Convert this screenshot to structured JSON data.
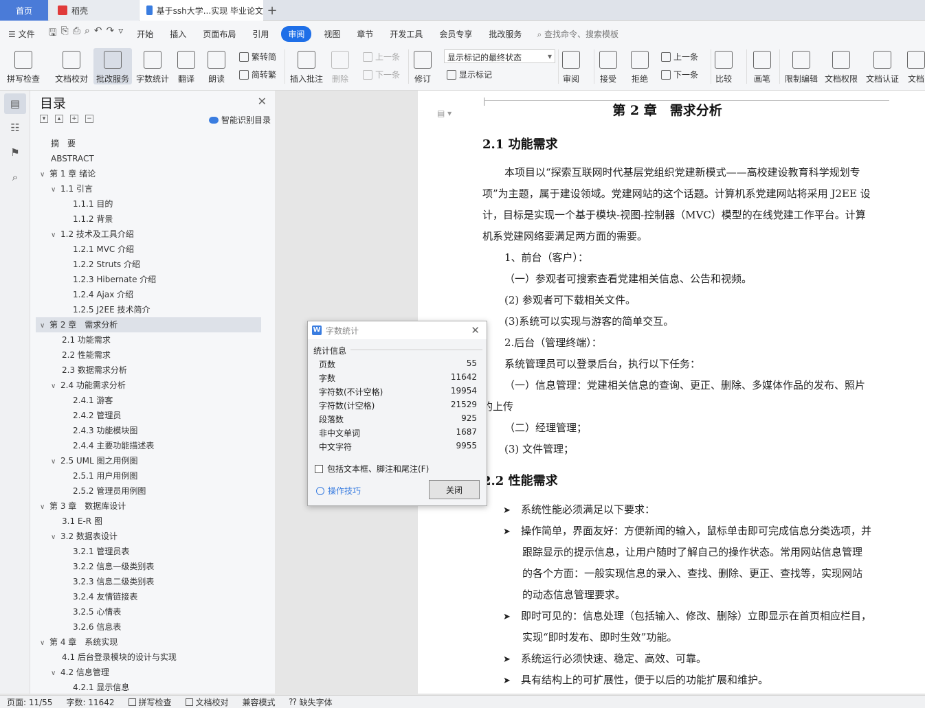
{
  "tabs": {
    "home": "首页",
    "daoke": "稻壳",
    "doc": "基于ssh大学...实现 毕业论文",
    "add": "+"
  },
  "menu": {
    "file": "文件",
    "items": [
      "开始",
      "插入",
      "页面布局",
      "引用",
      "审阅",
      "视图",
      "章节",
      "开发工具",
      "会员专享",
      "批改服务"
    ],
    "active": "审阅",
    "search": "查找命令、搜索模板"
  },
  "ribbon": {
    "spell": "拼写检查",
    "proof": "文档校对",
    "revise_service": "批改服务",
    "word_count": "字数统计",
    "translate": "翻译",
    "read": "朗读",
    "trad": "繁转简",
    "simp": "简转繁",
    "insert_comment": "插入批注",
    "delete": "删除",
    "prev": "上一条",
    "next": "下一条",
    "track": "修订",
    "display_combo": "显示标记的最终状态",
    "show_marks": "显示标记",
    "review": "审阅",
    "accept": "接受",
    "reject": "拒绝",
    "prev2": "上一条",
    "next2": "下一条",
    "compare": "比较",
    "pen": "画笔",
    "restrict": "限制编辑",
    "perm": "文档权限",
    "cert": "文档认证",
    "more": "文档"
  },
  "toc": {
    "title": "目录",
    "smart": "智能识别目录",
    "items": [
      {
        "label": "摘　要",
        "level": 0,
        "tw": ""
      },
      {
        "label": "ABSTRACT",
        "level": 0,
        "tw": ""
      },
      {
        "label": "第 1 章  绪论",
        "level": 0,
        "tw": "∨"
      },
      {
        "label": "1.1  引言",
        "level": 1,
        "tw": "∨"
      },
      {
        "label": "1.1.1 目的",
        "level": 2,
        "tw": ""
      },
      {
        "label": "1.1.2  背景",
        "level": 2,
        "tw": ""
      },
      {
        "label": "1.2  技术及工具介绍",
        "level": 1,
        "tw": "∨"
      },
      {
        "label": "1.2.1 MVC 介绍",
        "level": 2,
        "tw": ""
      },
      {
        "label": "1.2.2 Struts 介绍",
        "level": 2,
        "tw": ""
      },
      {
        "label": "1.2.3 Hibernate 介绍",
        "level": 2,
        "tw": ""
      },
      {
        "label": "1.2.4 Ajax 介绍",
        "level": 2,
        "tw": ""
      },
      {
        "label": "1.2.5 J2EE 技术简介",
        "level": 2,
        "tw": ""
      },
      {
        "label": "第 2 章　需求分析",
        "level": 0,
        "tw": "∨",
        "selected": true
      },
      {
        "label": "2.1  功能需求",
        "level": 1,
        "tw": ""
      },
      {
        "label": "2.2  性能需求",
        "level": 1,
        "tw": ""
      },
      {
        "label": "2.3  数据需求分析",
        "level": 1,
        "tw": ""
      },
      {
        "label": "2.4  功能需求分析",
        "level": 1,
        "tw": "∨"
      },
      {
        "label": "2.4.1  游客",
        "level": 2,
        "tw": ""
      },
      {
        "label": "2.4.2  管理员",
        "level": 2,
        "tw": ""
      },
      {
        "label": "2.4.3  功能模块图",
        "level": 2,
        "tw": ""
      },
      {
        "label": "2.4.4  主要功能描述表",
        "level": 2,
        "tw": ""
      },
      {
        "label": "2.5 UML 图之用例图",
        "level": 1,
        "tw": "∨"
      },
      {
        "label": "2.5.1  用户用例图",
        "level": 2,
        "tw": ""
      },
      {
        "label": "2.5.2  管理员用例图",
        "level": 2,
        "tw": ""
      },
      {
        "label": "第 3 章　数据库设计",
        "level": 0,
        "tw": "∨"
      },
      {
        "label": "3.1 E-R  图",
        "level": 1,
        "tw": ""
      },
      {
        "label": "3.2  数据表设计",
        "level": 1,
        "tw": "∨"
      },
      {
        "label": "3.2.1  管理员表",
        "level": 2,
        "tw": ""
      },
      {
        "label": "3.2.2  信息一级类别表",
        "level": 2,
        "tw": ""
      },
      {
        "label": "3.2.3  信息二级类别表",
        "level": 2,
        "tw": ""
      },
      {
        "label": "3.2.4  友情链接表",
        "level": 2,
        "tw": ""
      },
      {
        "label": "3.2.5  心情表",
        "level": 2,
        "tw": ""
      },
      {
        "label": "3.2.6  信息表",
        "level": 2,
        "tw": ""
      },
      {
        "label": "第 4 章　系统实现",
        "level": 0,
        "tw": "∨"
      },
      {
        "label": "4.1  后台登录模块的设计与实现",
        "level": 1,
        "tw": ""
      },
      {
        "label": "4.2  信息管理",
        "level": 1,
        "tw": "∨"
      },
      {
        "label": "4.2.1  显示信息",
        "level": 2,
        "tw": ""
      }
    ]
  },
  "doc": {
    "chapter": "第 2 章　需求分析",
    "sec1": "2.1  功能需求",
    "p1": [
      "本项目以“探索互联网时代基层党组织党建新模式——高校建设教育科学规划专",
      "项”为主题，属于建设领域。党建网站的这个话题。计算机系党建网站将采用 J2EE 设",
      "计，目标是实现一个基于模块-视图-控制器（MVC）模型的在线党建工作平台。计算",
      "机系党建网络要满足两方面的需要。"
    ],
    "l1": "1、前台（客户）：",
    "l2": "（一）参观者可搜索查看党建相关信息、公告和视频。",
    "l3": "(2)  参观者可下载相关文件。",
    "l4": "(3)系统可以实现与游客的简单交互。",
    "l5": "2.后台（管理终端）：",
    "l6": "系统管理员可以登录后台，执行以下任务：",
    "l7a": "（一）信息管理：党建相关信息的查询、更正、删除、多媒体作品的发布、照片",
    "l7b": "的上传",
    "l8": "（二）经理管理；",
    "l9": "(3)  文件管理；",
    "sec2": "2.2  性能需求",
    "b1": "系统性能必须满足以下要求：",
    "b2": [
      "操作简单，界面友好：方便新闻的输入，鼠标单击即可完成信息分类选项，并",
      "跟踪显示的提示信息，让用户随时了解自己的操作状态。常用网站信息管理",
      "的各个方面：一般实现信息的录入、查找、删除、更正、查找等，实现网站",
      "的动态信息管理要求。"
    ],
    "b3": [
      "即时可见的：信息处理（包括输入、修改、删除）立即显示在首页相应栏目，",
      "实现“即时发布、即时生效”功能。"
    ],
    "b4": "系统运行必须快速、稳定、高效、可靠。",
    "b5": "具有结构上的可扩展性，便于以后的功能扩展和维护。"
  },
  "dialog": {
    "title": "字数统计",
    "section": "统计信息",
    "stats": [
      {
        "label": "页数",
        "value": "55"
      },
      {
        "label": "字数",
        "value": "11642"
      },
      {
        "label": "字符数(不计空格)",
        "value": "19954"
      },
      {
        "label": "字符数(计空格)",
        "value": "21529"
      },
      {
        "label": "段落数",
        "value": "925"
      },
      {
        "label": "非中文单词",
        "value": "1687"
      },
      {
        "label": "中文字符",
        "value": "9955"
      }
    ],
    "include": "包括文本框、脚注和尾注(F)",
    "tips": "操作技巧",
    "close": "关闭"
  },
  "status": {
    "page": "页面: 11/55",
    "words": "字数: 11642",
    "spell": "拼写检查",
    "proof": "文档校对",
    "compat": "兼容模式",
    "missing_font": "缺失字体"
  }
}
